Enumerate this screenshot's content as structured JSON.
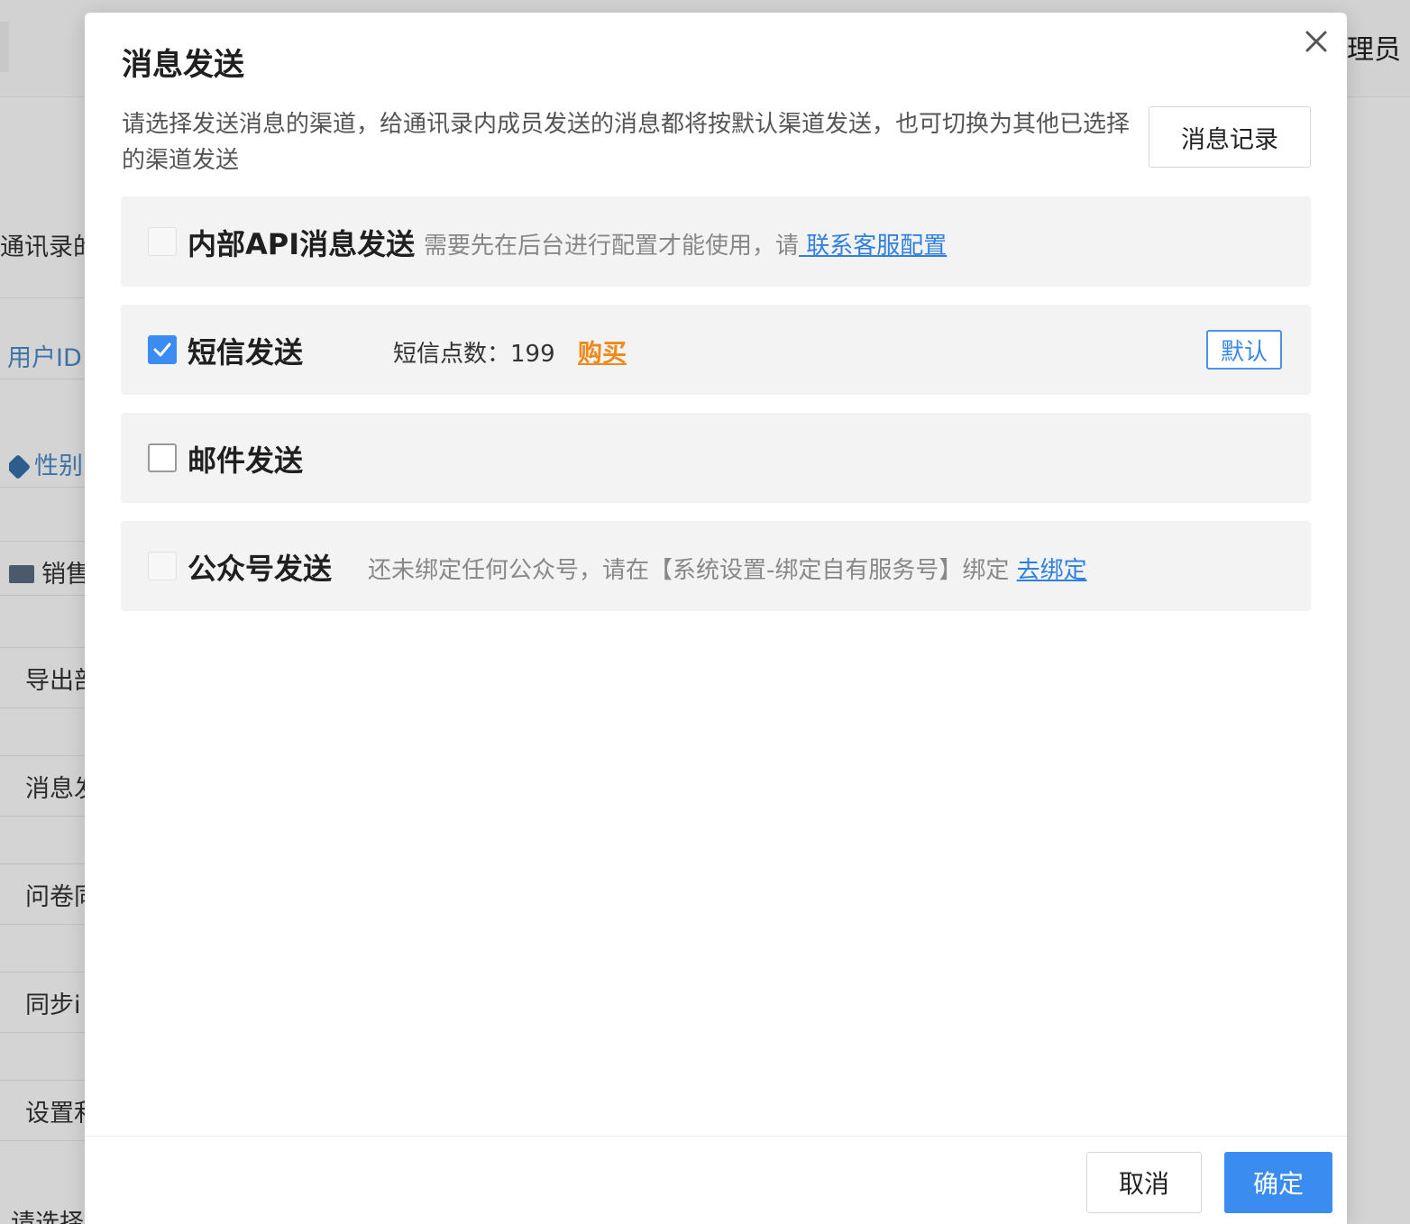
{
  "background": {
    "admin_label": "理员",
    "rows": [
      {
        "text": "通讯录的"
      },
      {
        "text": "用户ID"
      },
      {
        "text": "性别"
      },
      {
        "text": "销售"
      },
      {
        "text": "导出部"
      },
      {
        "text": "消息发"
      },
      {
        "text": "问卷同"
      },
      {
        "text": "同步i"
      },
      {
        "text": "设置利"
      },
      {
        "text": "请选择"
      }
    ]
  },
  "modal": {
    "title": "消息发送",
    "intro": "请选择发送消息的渠道，给通讯录内成员发送的消息都将按默认渠道发送，也可切换为其他已选择的渠道发送",
    "history_button": "消息记录",
    "channels": [
      {
        "name": "内部API消息发送",
        "checked": false,
        "disabled": true,
        "note": "需要先在后台进行配置才能使用，请",
        "link": " 联系客服配置"
      },
      {
        "name": "短信发送",
        "checked": true,
        "disabled": false,
        "count_label": "短信点数：199",
        "buy_link": "购买",
        "default_tag": "默认"
      },
      {
        "name": "邮件发送",
        "checked": false,
        "disabled": false
      },
      {
        "name": "公众号发送",
        "checked": false,
        "disabled": true,
        "note": "还未绑定任何公众号，请在【系统设置-绑定自有服务号】绑定",
        "link": "去绑定"
      }
    ],
    "cancel_button": "取消",
    "confirm_button": "确定"
  },
  "colors": {
    "primary": "#3b8cf0",
    "link": "#2f80e0",
    "buy": "#ef8a1a",
    "channel_bg": "#f3f3f3"
  }
}
